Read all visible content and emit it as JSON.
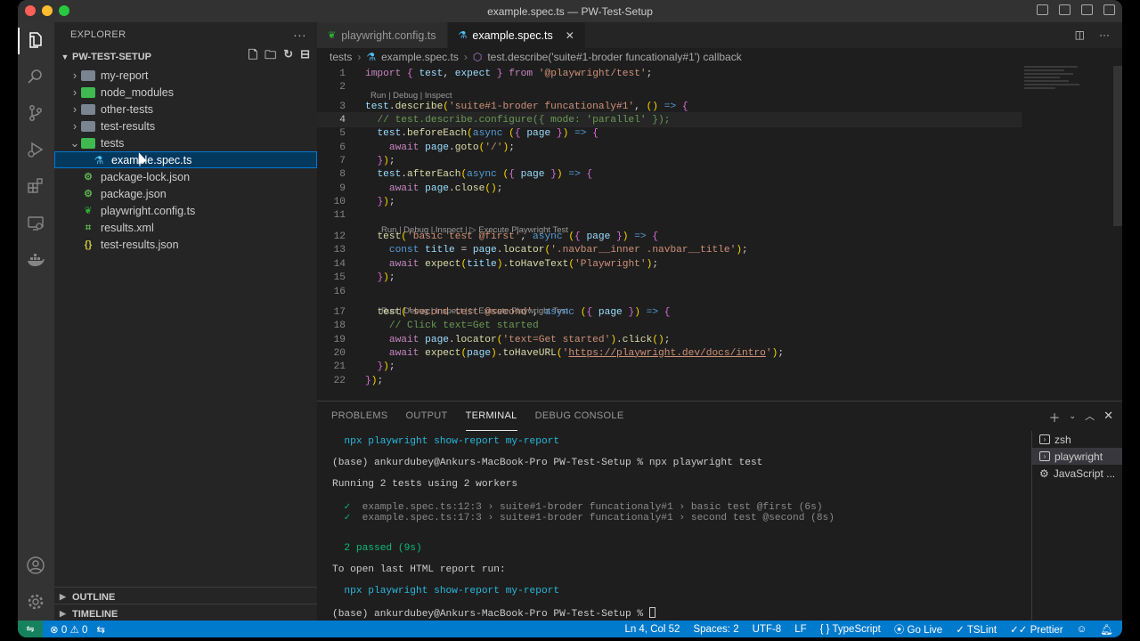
{
  "window": {
    "title": "example.spec.ts — PW-Test-Setup"
  },
  "activity_bar": {
    "icons": [
      "explorer-icon",
      "search-icon",
      "source-control-icon",
      "run-debug-icon",
      "extensions-icon",
      "remote-explorer-icon",
      "docker-icon",
      "account-icon",
      "settings-gear-icon"
    ]
  },
  "sidebar": {
    "header": "EXPLORER",
    "project": "PW-TEST-SETUP",
    "tree": [
      {
        "label": "my-report",
        "type": "folder",
        "expanded": false,
        "depth": 1
      },
      {
        "label": "node_modules",
        "type": "folder-green",
        "expanded": false,
        "depth": 1
      },
      {
        "label": "other-tests",
        "type": "folder",
        "expanded": false,
        "depth": 1
      },
      {
        "label": "test-results",
        "type": "folder",
        "expanded": false,
        "depth": 1
      },
      {
        "label": "tests",
        "type": "folder-green",
        "expanded": true,
        "depth": 1
      },
      {
        "label": "example.spec.ts",
        "type": "test",
        "depth": 2,
        "selected": true
      },
      {
        "label": "package-lock.json",
        "type": "json",
        "depth": 1
      },
      {
        "label": "package.json",
        "type": "json",
        "depth": 1
      },
      {
        "label": "playwright.config.ts",
        "type": "playwright",
        "depth": 1
      },
      {
        "label": "results.xml",
        "type": "xml",
        "depth": 1
      },
      {
        "label": "test-results.json",
        "type": "brace",
        "depth": 1
      }
    ],
    "outline": "OUTLINE",
    "timeline": "TIMELINE"
  },
  "tabs": [
    {
      "label": "playwright.config.ts",
      "active": false
    },
    {
      "label": "example.spec.ts",
      "active": true
    }
  ],
  "breadcrumb": {
    "folder": "tests",
    "file": "example.spec.ts",
    "symbol": "test.describe('suite#1-broder funcationaly#1') callback"
  },
  "code": {
    "current_line": 4,
    "lines": [
      "import { test, expect } from '@playwright/test';",
      "",
      "test.describe('suite#1-broder funcationaly#1', () => {",
      "  // test.describe.configure({ mode: 'parallel' });",
      "  test.beforeEach(async ({ page }) => {",
      "    await page.goto('/');",
      "  });",
      "  test.afterEach(async ({ page }) => {",
      "    await page.close();",
      "  });",
      "",
      "  test('basic test @first', async ({ page }) => {",
      "    const title = page.locator('.navbar__inner .navbar__title');",
      "    await expect(title).toHaveText('Playwright');",
      "  });",
      "",
      "  test('second test @second', async ({ page }) => {",
      "    // Click text=Get started",
      "    await page.locator('text=Get started').click();",
      "    await expect(page).toHaveURL('https://playwright.dev/docs/intro');",
      "  });",
      "});"
    ],
    "codelens_describe": "Run | Debug | Inspect",
    "codelens_test": "Run | Debug | Inspect | ▷ Execute Playwright Test"
  },
  "panel": {
    "tabs": [
      "PROBLEMS",
      "OUTPUT",
      "TERMINAL",
      "DEBUG CONSOLE"
    ],
    "active_tab": "TERMINAL",
    "terminal_lines": [
      "  npx playwright show-report my-report",
      "",
      "(base) ankurdubey@Ankurs-MacBook-Pro PW-Test-Setup % npx playwright test",
      "",
      "Running 2 tests using 2 workers",
      "",
      "  ✓  example.spec.ts:12:3 › suite#1-broder funcationaly#1 › basic test @first (6s)",
      "  ✓  example.spec.ts:17:3 › suite#1-broder funcationaly#1 › second test @second (8s)",
      "",
      "",
      "  2 passed (9s)",
      "",
      "To open last HTML report run:",
      "",
      "  npx playwright show-report my-report",
      "",
      "(base) ankurdubey@Ankurs-MacBook-Pro PW-Test-Setup % "
    ],
    "terminals": [
      {
        "label": "zsh",
        "active": false
      },
      {
        "label": "playwright",
        "active": true
      },
      {
        "label": "JavaScript ...",
        "active": false
      }
    ]
  },
  "status_bar": {
    "errors": "0",
    "warnings": "0",
    "position": "Ln 4, Col 52",
    "spaces": "Spaces: 2",
    "encoding": "UTF-8",
    "eol": "LF",
    "language": "TypeScript",
    "golive": "Go Live",
    "tslint": "TSLint",
    "prettier": "Prettier"
  }
}
